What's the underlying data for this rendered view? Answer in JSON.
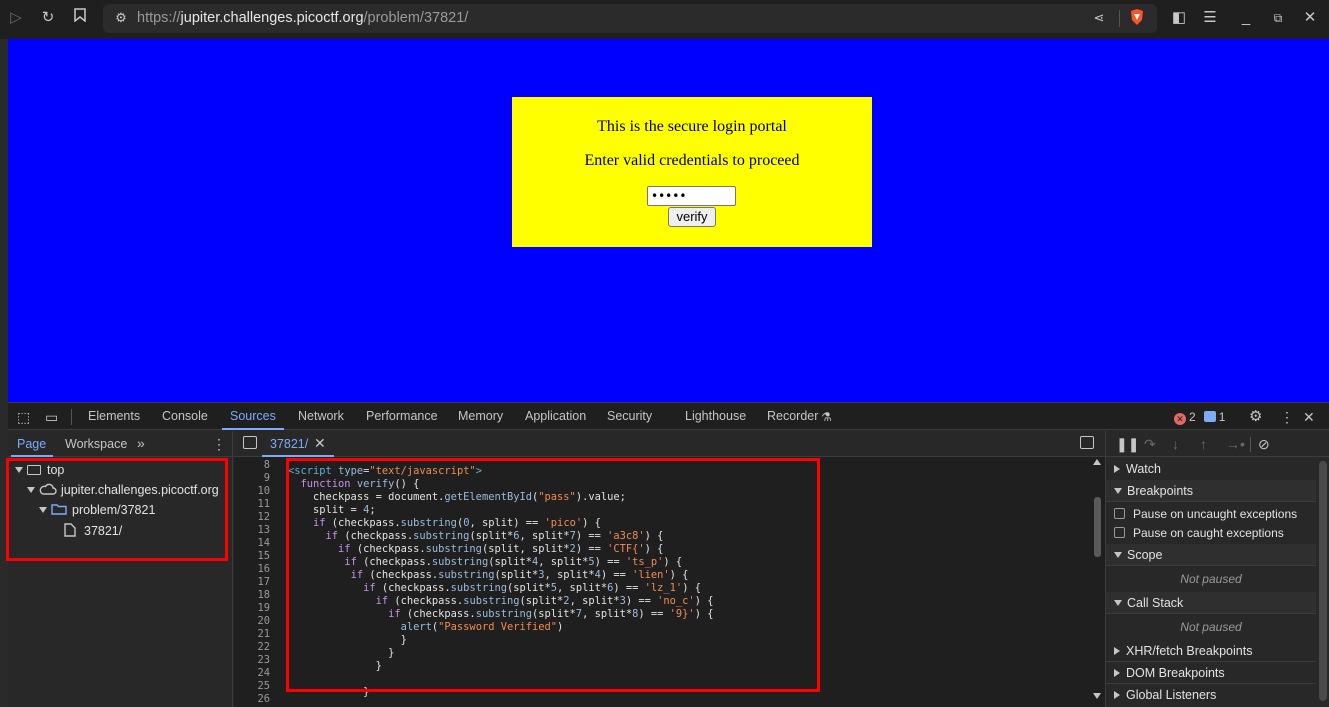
{
  "browser": {
    "url_host": "jupiter.challenges.picoctf.org",
    "url_path": "/problem/37821/",
    "url_scheme": "https://"
  },
  "page": {
    "line1": "This is the secure login portal",
    "line2": "Enter valid credentials to proceed",
    "password_value": "•••••",
    "verify_label": "verify"
  },
  "devtools": {
    "tabs": [
      "Elements",
      "Console",
      "Sources",
      "Network",
      "Performance",
      "Memory",
      "Application",
      "Security",
      "Lighthouse",
      "Recorder"
    ],
    "error_count": "2",
    "message_count": "1"
  },
  "navigator": {
    "tabs": [
      "Page",
      "Workspace"
    ],
    "tree": [
      "top",
      "jupiter.challenges.picoctf.org",
      "problem/37821",
      "37821/"
    ]
  },
  "editor": {
    "file_tab": "37821/",
    "line_numbers": [
      "8",
      "9",
      "10",
      "11",
      "12",
      "13",
      "14",
      "15",
      "16",
      "17",
      "18",
      "19",
      "20",
      "21",
      "22",
      "23",
      "24",
      "25",
      "26"
    ]
  },
  "debugger": {
    "watch": "Watch",
    "breakpoints": "Breakpoints",
    "pause_uncaught": "Pause on uncaught exceptions",
    "pause_caught": "Pause on caught exceptions",
    "scope": "Scope",
    "scope_status": "Not paused",
    "call_stack": "Call Stack",
    "call_stack_status": "Not paused",
    "xhr": "XHR/fetch Breakpoints",
    "dom": "DOM Breakpoints",
    "global": "Global Listeners"
  },
  "colors": {
    "page_bg": "#0000ff",
    "login_bg": "#ffff00",
    "highlight": "#ff0000",
    "accent": "#7cacf8"
  }
}
